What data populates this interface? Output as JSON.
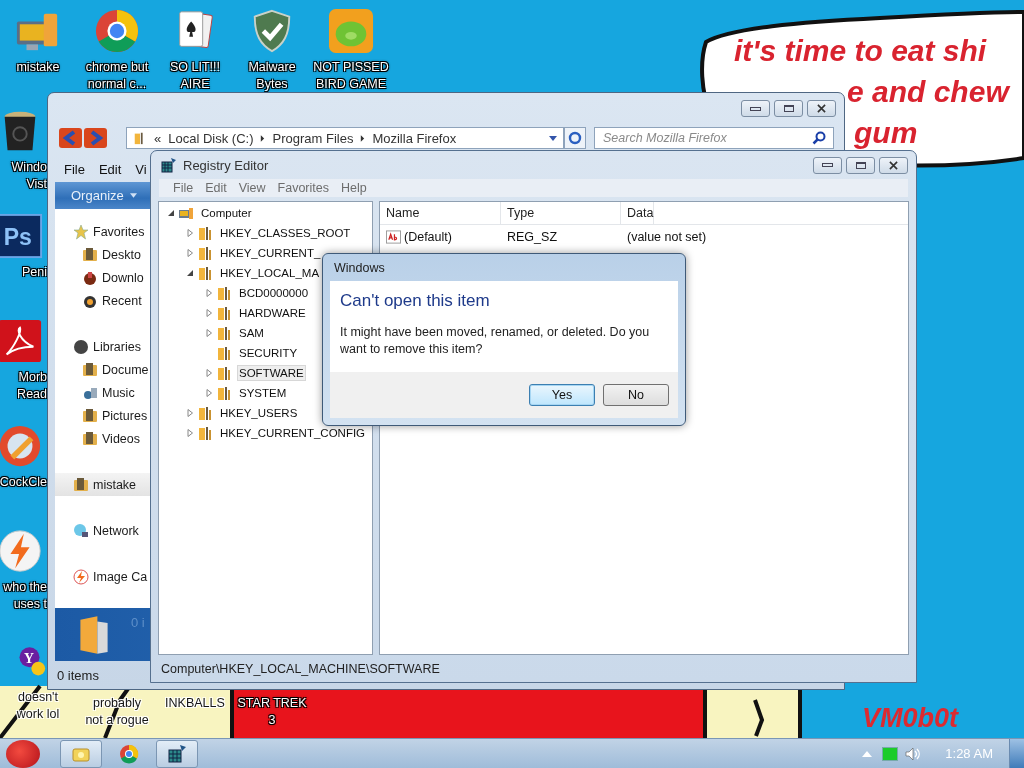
{
  "wallpaper": {
    "bubble_lines": [
      "it's time to eat shi",
      "e and chew",
      "gum"
    ],
    "signature": "VM0b0t"
  },
  "desktop_icons": {
    "top_row": [
      {
        "kind": "computer",
        "lines": [
          "mistake"
        ]
      },
      {
        "kind": "chrome",
        "lines": [
          "chrome but",
          "normal c..."
        ]
      },
      {
        "kind": "cards",
        "lines": [
          "SO LIT!!!",
          "AIRE"
        ]
      },
      {
        "kind": "shield",
        "lines": [
          "Malware",
          "Bytes"
        ]
      },
      {
        "kind": "game",
        "lines": [
          "NOT PISSED",
          "BIRD GAME"
        ]
      }
    ],
    "left_column": [
      {
        "kind": "bin",
        "lines": [
          "Windo",
          "Vist"
        ]
      },
      {
        "kind": "ps",
        "glyph": "Ps",
        "lines": [
          "Peni"
        ]
      },
      {
        "kind": "pdf",
        "lines": [
          "Morb",
          "Read"
        ]
      },
      {
        "kind": "cleaner",
        "lines": [
          "CockCle"
        ]
      },
      {
        "kind": "bolt",
        "lines": [
          "who the",
          "uses t"
        ]
      }
    ],
    "bottom_row": [
      {
        "kind": "yahoo",
        "glyph": "Y",
        "lines": [
          "doesn't",
          "work lol"
        ]
      },
      {
        "lines": [
          "probably",
          "not a rogue"
        ]
      },
      {
        "lines": [
          "INKBALLS"
        ]
      },
      {
        "lines": [
          "STAR TREK",
          "3"
        ]
      }
    ]
  },
  "explorer": {
    "address": {
      "overflow_glyph": "«",
      "crumbs": [
        "Local Disk (C:)",
        "Program Files",
        "Mozilla Firefox"
      ]
    },
    "search": {
      "placeholder": "Search Mozilla Firefox"
    },
    "menu": [
      "File",
      "Edit",
      "Vi"
    ],
    "toolbar": {
      "organize": "Organize"
    },
    "nav": [
      {
        "items": [
          {
            "kind": "favorites",
            "label": "Favorites",
            "selected": false
          },
          {
            "kind": "desktop",
            "label": "Deskto",
            "selected": false
          },
          {
            "kind": "downloads",
            "label": "Downlo",
            "selected": false
          },
          {
            "kind": "recent",
            "label": "Recent",
            "selected": false
          }
        ]
      },
      {
        "items": [
          {
            "kind": "libraries",
            "label": "Libraries",
            "selected": false
          },
          {
            "kind": "documents",
            "label": "Docume",
            "selected": false
          },
          {
            "kind": "music",
            "label": "Music",
            "selected": false
          },
          {
            "kind": "pictures",
            "label": "Pictures",
            "selected": false
          },
          {
            "kind": "videos",
            "label": "Videos",
            "selected": false
          }
        ]
      },
      {
        "items": [
          {
            "kind": "user",
            "label": "mistake",
            "selected": true
          }
        ]
      },
      {
        "items": [
          {
            "kind": "network",
            "label": "Network",
            "selected": false
          }
        ]
      },
      {
        "items": [
          {
            "kind": "bolt",
            "label": "Image Ca",
            "selected": false
          }
        ]
      }
    ],
    "details": "0 i",
    "status": "0 items"
  },
  "registry": {
    "title": "Registry Editor",
    "menu": [
      "File",
      "Edit",
      "View",
      "Favorites",
      "Help"
    ],
    "tree": [
      {
        "label": "Computer",
        "kind": "computer",
        "expandable": true,
        "expanded": true,
        "selected": false,
        "children": [
          {
            "label": "HKEY_CLASSES_ROOT",
            "kind": "key",
            "expandable": true,
            "expanded": false,
            "selected": false
          },
          {
            "label": "HKEY_CURRENT_",
            "kind": "key",
            "expandable": true,
            "expanded": false,
            "selected": false
          },
          {
            "label": "HKEY_LOCAL_MA",
            "kind": "key",
            "expandable": true,
            "expanded": true,
            "selected": false,
            "children": [
              {
                "label": "BCD0000000",
                "kind": "key",
                "expandable": true,
                "expanded": false,
                "selected": false
              },
              {
                "label": "HARDWARE",
                "kind": "key",
                "expandable": true,
                "expanded": false,
                "selected": false
              },
              {
                "label": "SAM",
                "kind": "key",
                "expandable": true,
                "expanded": false,
                "selected": false
              },
              {
                "label": "SECURITY",
                "kind": "key",
                "expandable": false,
                "expanded": false,
                "selected": false
              },
              {
                "label": "SOFTWARE",
                "kind": "key",
                "expandable": true,
                "expanded": false,
                "selected": true
              },
              {
                "label": "SYSTEM",
                "kind": "key",
                "expandable": true,
                "expanded": false,
                "selected": false
              }
            ]
          },
          {
            "label": "HKEY_USERS",
            "kind": "key",
            "expandable": true,
            "expanded": false,
            "selected": false
          },
          {
            "label": "HKEY_CURRENT_CONFIG",
            "kind": "key",
            "expandable": true,
            "expanded": false,
            "selected": false
          }
        ]
      }
    ],
    "columns": [
      "Name",
      "Type",
      "Data"
    ],
    "values": [
      {
        "name": "(Default)",
        "type": "REG_SZ",
        "data": "(value not set)"
      }
    ],
    "status": "Computer\\HKEY_LOCAL_MACHINE\\SOFTWARE"
  },
  "dialog": {
    "title": "Windows",
    "heading": "Can't open this item",
    "message": "It might have been moved, renamed, or deleted. Do you want to remove this item?",
    "buttons": [
      {
        "label": "Yes",
        "default": true
      },
      {
        "label": "No",
        "default": false
      }
    ]
  },
  "taskbar": {
    "buttons": [
      {
        "kind": "explorer",
        "open": true
      },
      {
        "kind": "chrome",
        "open": false
      },
      {
        "kind": "regedit",
        "open": true
      }
    ],
    "clock": "1:28 AM"
  }
}
